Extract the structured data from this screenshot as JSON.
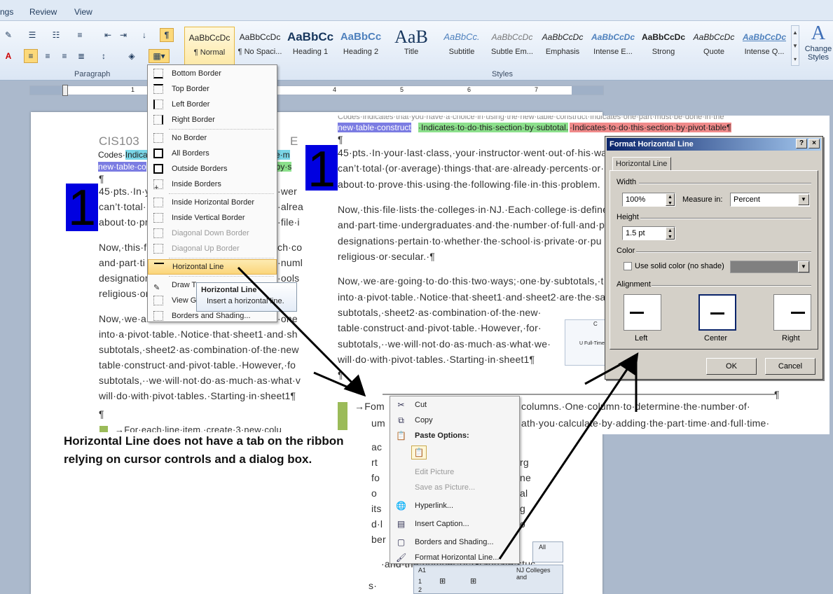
{
  "menubar": {
    "tabs": [
      "ngs",
      "Review",
      "View"
    ]
  },
  "ribbon": {
    "paragraph_label": "Paragraph",
    "styles_label": "Styles",
    "change_styles": "Change Styles",
    "pilcrow": "¶",
    "styles": [
      {
        "preview": "AaBbCcDc",
        "name": "¶ Normal",
        "selected": true
      },
      {
        "preview": "AaBbCcDc",
        "name": "¶ No Spaci..."
      },
      {
        "preview": "AaBbCc",
        "name": "Heading 1"
      },
      {
        "preview": "AaBbCc",
        "name": "Heading 2"
      },
      {
        "preview": "AaB",
        "name": "Title"
      },
      {
        "preview": "AaBbCc.",
        "name": "Subtitle"
      },
      {
        "preview": "AaBbCcDc",
        "name": "Subtle Em..."
      },
      {
        "preview": "AaBbCcDc",
        "name": "Emphasis"
      },
      {
        "preview": "AaBbCcDc",
        "name": "Intense E..."
      },
      {
        "preview": "AaBbCcDc",
        "name": "Strong"
      },
      {
        "preview": "AaBbCcDc",
        "name": "Quote"
      },
      {
        "preview": "AaBbCcDc",
        "name": "Intense Q..."
      }
    ]
  },
  "ruler": {
    "numbers": [
      "1",
      "2",
      "3",
      "4",
      "5",
      "6",
      "7"
    ]
  },
  "left_doc": {
    "header": "CIS103",
    "header_right": "E",
    "codes_prefix": "Codes·",
    "codes_hl1": "Indica",
    "codes_hl2": "·the·m",
    "codes_line2_a": "new·table·co",
    "codes_line2_b": "·n·by·s",
    "pilcrow": "¶",
    "dropcap": "1",
    "p1": [
      "45·pts.·In·y",
      "can’t·total·",
      "about·to·pr"
    ],
    "p1_right": [
      "·wer",
      "·alrea",
      "·file·i"
    ],
    "p2": [
      "Now,·this·f",
      "and·part·ti",
      "designation",
      "religious·or"
    ],
    "p2_right": [
      "ch·co",
      "·numl",
      "·ools",
      ""
    ],
    "p3": [
      "Now,·we·a",
      "into·a·pivot·table.·Notice·that·sheet1·and·sh",
      "subtotals,·sheet2·as·combination·of·the·new",
      "table·construct·and·pivot·table.·However,·fo",
      "subtotals,··we·will·not·do·as·much·as·what·v",
      "will·do·with·pivot·tables.·Starting·in·sheet1¶"
    ],
    "p3_right": "·one",
    "bullet": "→For·each·line·item,·create·3·new·colu"
  },
  "right_doc": {
    "codes_line1": "Codes·Indicates·that·you·have·a·choice·in·using·the·new·table·construct·Indicates·one·part·must·be·done·in·the",
    "codes_a": "new·table·construct",
    "codes_b": "·Indicates·to·do·this·section·by·subtotal.",
    "codes_c": "·Indicates·to·do·this·section·by·pivot·table¶",
    "pilcrow": "¶",
    "dropcap": "1",
    "p1": [
      "45·pts.·In·your·last·class,·your·instructor·went·out·of·his·wa",
      "can’t·total·(or·average)·things·that·are·already·percents·or·",
      "about·to·prove·this·using·the·following·file·in·this·problem."
    ],
    "p2": [
      "Now,·this·file·lists·the·colleges·in·NJ.·Each·college·is·defined",
      "and·part·time·undergraduates·and·the·number·of·full·and·p",
      "designations·pertain·to·whether·the·school·is·private·or·pu",
      "religious·or·secular.·¶"
    ],
    "p3": [
      "Now,·we·are·going·to·do·this·two·ways;·one·by·subtotals,·t",
      "into·a·pivot·table.·Notice·that·sheet1·and·sheet2·are·the·sa",
      "subtotals,·sheet2·as·combination·of·the·new·",
      "table·construct·and·pivot·table.·However,·for·",
      "subtotals,··we·will·not·do·as·much·as·what·we·",
      "will·do·with·pivot·tables.·Starting·in·sheet1¶"
    ],
    "line_pilcrow": "¶",
    "lower_lines": [
      "→Fom",
      "columns.·One·column·to·determine·the·number·of·",
      "um",
      "ath·you·calculate·by·adding·the·part·time·and·full·time·"
    ],
    "excel_cells": [
      "C",
      "U Full-Time"
    ]
  },
  "border_menu": {
    "items": [
      {
        "label": "Bottom Border",
        "state": "normal"
      },
      {
        "label": "Top Border",
        "state": "normal"
      },
      {
        "label": "Left Border",
        "state": "normal"
      },
      {
        "label": "Right Border",
        "state": "normal"
      },
      {
        "label": "No Border",
        "state": "normal"
      },
      {
        "label": "All Borders",
        "state": "normal"
      },
      {
        "label": "Outside Borders",
        "state": "normal"
      },
      {
        "label": "Inside Borders",
        "state": "normal"
      },
      {
        "label": "Inside Horizontal Border",
        "state": "normal"
      },
      {
        "label": "Inside Vertical Border",
        "state": "normal"
      },
      {
        "label": "Diagonal Down Border",
        "state": "disabled"
      },
      {
        "label": "Diagonal Up Border",
        "state": "disabled"
      },
      {
        "label": "Horizontal Line",
        "state": "hot"
      },
      {
        "label": "Draw T",
        "state": "normal"
      },
      {
        "label": "View G",
        "state": "normal"
      },
      {
        "label": "Borders and Shading...",
        "state": "normal"
      }
    ]
  },
  "tooltip": {
    "title": "Horizontal Line",
    "body": "Insert a horizontal line."
  },
  "context_menu": {
    "cut": "Cut",
    "copy": "Copy",
    "paste_header": "Paste Options:",
    "edit_picture": "Edit Picture",
    "save_as_picture": "Save as Picture...",
    "hyperlink": "Hyperlink...",
    "insert_caption": "Insert Caption...",
    "borders_shading": "Borders and Shading...",
    "format_hline": "Format Horizontal Line..."
  },
  "behind_menu": [
    "ac",
    "rt",
    "fo",
    "o",
    "its",
    "d·l",
    "rg",
    "ne",
    "al",
    "ber",
    "g",
    "o",
    "·and·the·number·of·Graduate·stuc",
    "s·"
  ],
  "excel_fragment": {
    "cell": "A1",
    "name": "NJ Colleges and",
    "all": "All",
    "rows": [
      "1",
      "2"
    ]
  },
  "dialog": {
    "title": "Format Horizontal Line",
    "help": "?",
    "close": "×",
    "tab": "Horizontal Line",
    "width_label": "Width",
    "width_value": "100%",
    "measure_label": "Measure in:",
    "measure_value": "Percent",
    "height_label": "Height",
    "height_value": "1.5 pt",
    "color_label": "Color",
    "solid_color": "Use solid color (no shade)",
    "alignment_label": "Alignment",
    "align_left": "Left",
    "align_center": "Center",
    "align_right": "Right",
    "ok": "OK",
    "cancel": "Cancel"
  },
  "caption": {
    "line1": "Horizontal Line does not have a tab on the ribbon",
    "line2": "relying on cursor controls and a dialog box."
  }
}
